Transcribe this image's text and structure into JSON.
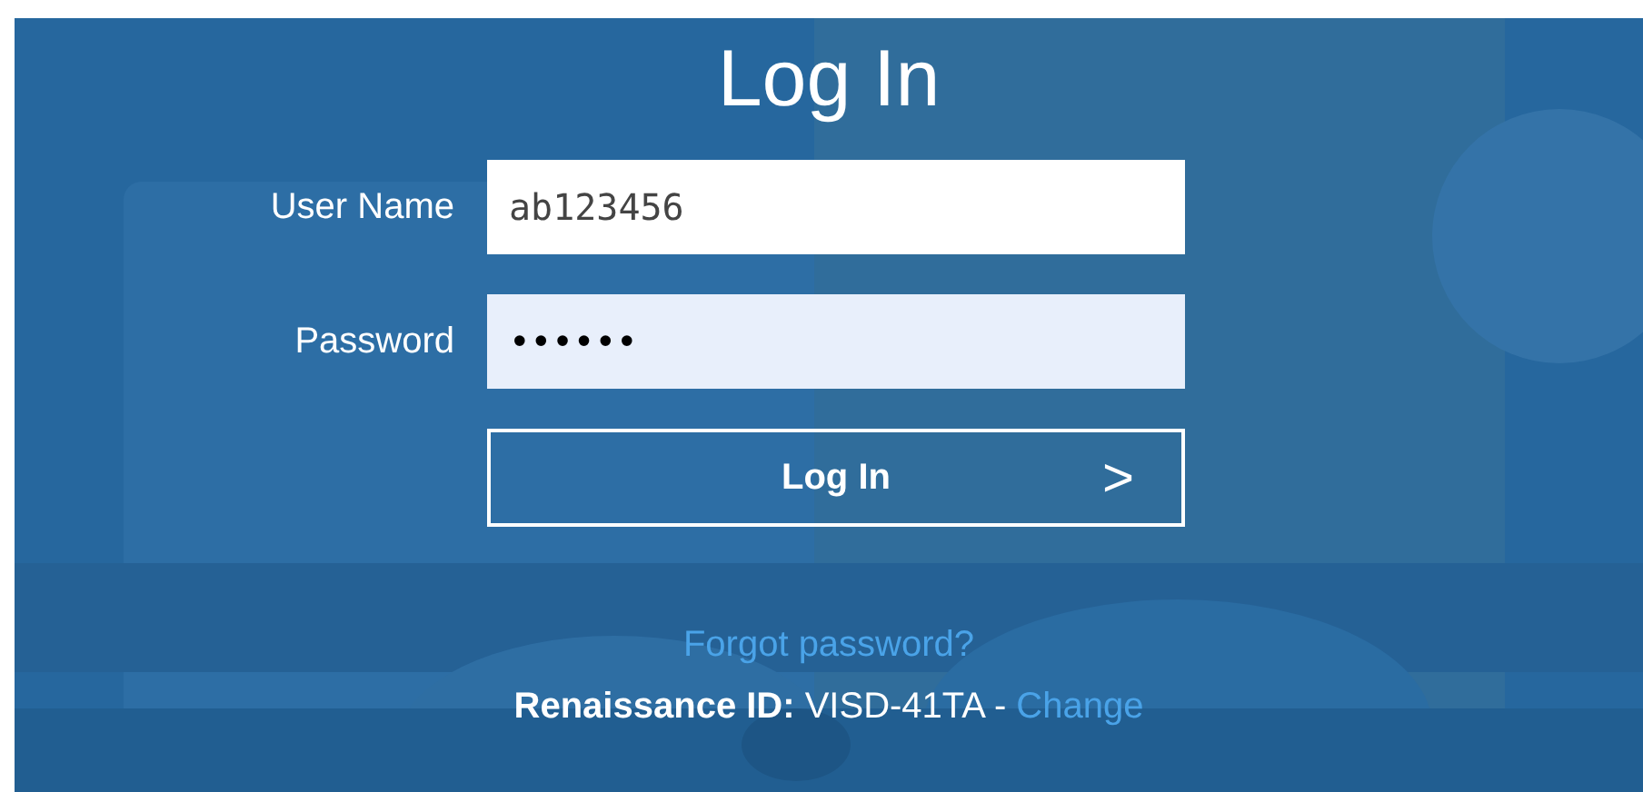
{
  "title": "Log In",
  "fields": [
    {
      "label": "User Name",
      "value": "ab123456",
      "kind": "text"
    },
    {
      "label": "Password",
      "value": "••••••",
      "kind": "password"
    }
  ],
  "submit": {
    "label": "Log In",
    "arrow": ">"
  },
  "forgot_link": "Forgot password?",
  "renaissance": {
    "text": "**Renaissance ID:** VISD-41TA - ",
    "link": "Change"
  }
}
